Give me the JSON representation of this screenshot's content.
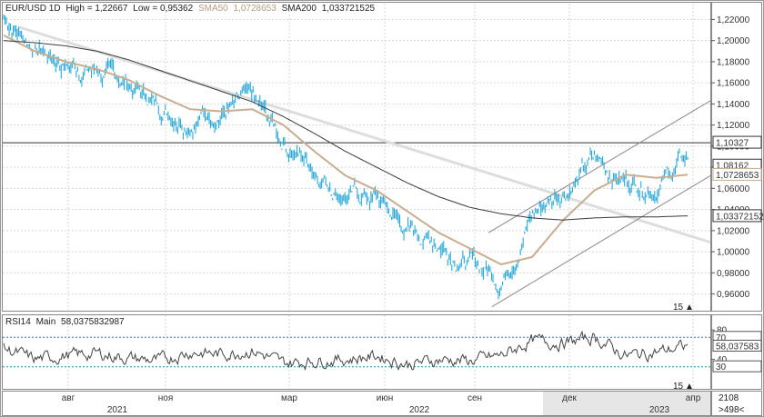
{
  "header": {
    "symbol": "EUR/USD 1D",
    "high_label": "High = 1,22667",
    "low_label": "Low = 0,95362",
    "sma50_label": "SMA50",
    "sma50_value": "1,0728653",
    "sma200_label": "SMA200",
    "sma200_value": "1,033721525"
  },
  "rsi_header": {
    "name": "RSI14",
    "mode": "Main",
    "value": "58,0375832987"
  },
  "price_axis": {
    "ticks": [
      "1,22000",
      "1,20000",
      "1,18000",
      "1,16000",
      "1,14000",
      "1,12000",
      "1,10000",
      "1,08000",
      "1,06000",
      "1,04000",
      "1,02000",
      "1,00000",
      "0,98000",
      "0,96000"
    ],
    "tags": [
      {
        "text": "1,10327",
        "value": 1.10327
      },
      {
        "text": "1,08162",
        "value": 1.08162
      },
      {
        "text": "1,0728653",
        "value": 1.0728653
      },
      {
        "text": "1,03372152",
        "value": 1.0337215
      }
    ]
  },
  "rsi_axis": {
    "ticks": [
      "80",
      "40"
    ],
    "tags": [
      {
        "text": "70",
        "value": 70
      },
      {
        "text": "58,037583",
        "value": 58.04
      },
      {
        "text": "30",
        "value": 30
      }
    ]
  },
  "bars_count_label": "15",
  "bars_count_label_rsi": "15",
  "time_axis": {
    "months": [
      "авг",
      "ноя",
      "мар",
      "июн",
      "сен",
      "дек",
      "апр"
    ],
    "years": [
      "2021",
      "2022",
      "2023"
    ]
  },
  "corner": {
    "total": "2108",
    "nav": ">498<"
  },
  "colors": {
    "price": "#2aa8d8",
    "sma50": "#c8ad93",
    "sma200": "#3a3a3a",
    "trend": "#dcdcdc",
    "channel": "#777777",
    "rsi": "#444444",
    "rsi_level": "#1a8fb0",
    "grid": "#d6d6d6",
    "tag_bg": "#ffffff"
  },
  "chart_data": [
    {
      "type": "line",
      "title": "EUR/USD 1D",
      "ylim": [
        0.945,
        1.235
      ],
      "grid": true,
      "series": [
        {
          "name": "EUR/USD",
          "x": [
            "2021-06",
            "2021-07",
            "2021-08",
            "2021-09",
            "2021-10",
            "2021-11",
            "2021-12",
            "2022-01",
            "2022-02",
            "2022-03",
            "2022-04",
            "2022-05",
            "2022-06",
            "2022-07",
            "2022-08",
            "2022-09",
            "2022-10",
            "2022-11",
            "2022-12",
            "2023-01",
            "2023-02",
            "2023-03",
            "2023-04"
          ],
          "values": [
            1.222,
            1.195,
            1.178,
            1.172,
            1.158,
            1.138,
            1.128,
            1.135,
            1.14,
            1.105,
            1.08,
            1.055,
            1.05,
            1.02,
            1.01,
            0.99,
            0.975,
            1.035,
            1.06,
            1.085,
            1.068,
            1.065,
            1.088
          ]
        },
        {
          "name": "SMA50",
          "values": [
            1.205,
            1.19,
            1.18,
            1.173,
            1.163,
            1.148,
            1.135,
            1.133,
            1.135,
            1.12,
            1.095,
            1.072,
            1.058,
            1.038,
            1.018,
            1.003,
            0.988,
            0.995,
            1.03,
            1.058,
            1.073,
            1.07,
            1.073
          ]
        },
        {
          "name": "SMA200",
          "values": [
            1.2,
            1.198,
            1.195,
            1.19,
            1.182,
            1.172,
            1.162,
            1.152,
            1.142,
            1.128,
            1.112,
            1.095,
            1.08,
            1.065,
            1.052,
            1.042,
            1.036,
            1.032,
            1.03,
            1.032,
            1.033,
            1.033,
            1.034
          ]
        }
      ]
    },
    {
      "type": "line",
      "title": "RSI14",
      "ylim": [
        0,
        100
      ],
      "levels": [
        70,
        30
      ],
      "series": [
        {
          "name": "RSI14",
          "values": [
            55,
            40,
            45,
            48,
            42,
            38,
            50,
            47,
            52,
            35,
            38,
            40,
            45,
            33,
            40,
            38,
            45,
            65,
            62,
            70,
            45,
            50,
            58
          ]
        }
      ]
    }
  ]
}
